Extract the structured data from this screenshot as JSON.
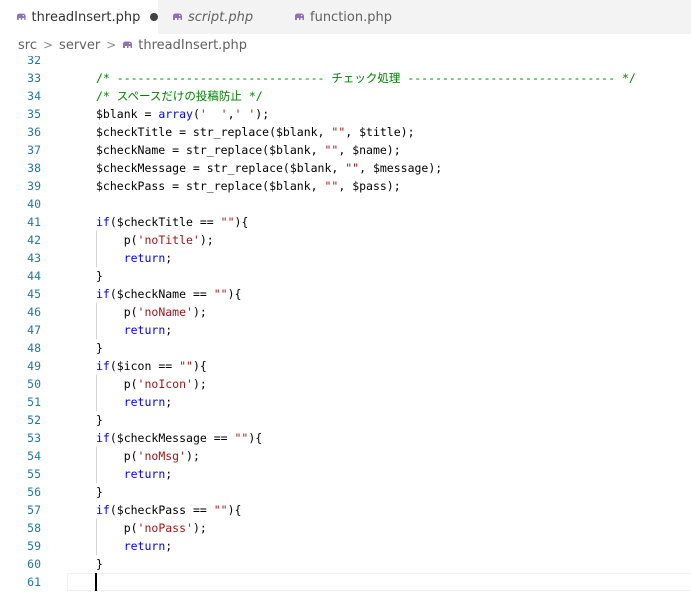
{
  "tabs": [
    {
      "label": "threadInsert.php",
      "icon": "php-elephant-icon",
      "active": true,
      "unsaved": true,
      "italic": false
    },
    {
      "label": "script.php",
      "icon": "php-elephant-icon",
      "active": false,
      "unsaved": false,
      "italic": true
    },
    {
      "label": "function.php",
      "icon": "php-elephant-icon",
      "active": false,
      "unsaved": false,
      "italic": false
    }
  ],
  "breadcrumb": {
    "items": [
      "src",
      "server",
      "threadInsert.php"
    ],
    "separator": ">"
  },
  "colors": {
    "line_number": "#237893",
    "comment": "#008000",
    "keyword": "#0000ff",
    "string": "#a31515",
    "php_icon": "#8f6fb8"
  },
  "editor": {
    "cursor_line": 61,
    "lines": [
      {
        "n": "32",
        "code": ""
      },
      {
        "n": "33",
        "code": "/* ------------------------------ チェック処理 ------------------------------ */"
      },
      {
        "n": "34",
        "code": "/* スペースだけの投稿防止 */"
      },
      {
        "n": "35",
        "code": "$blank = array('  ',' ');"
      },
      {
        "n": "36",
        "code": "$checkTitle = str_replace($blank, \"\", $title);"
      },
      {
        "n": "37",
        "code": "$checkName = str_replace($blank, \"\", $name);"
      },
      {
        "n": "38",
        "code": "$checkMessage = str_replace($blank, \"\", $message);"
      },
      {
        "n": "39",
        "code": "$checkPass = str_replace($blank, \"\", $pass);"
      },
      {
        "n": "40",
        "code": ""
      },
      {
        "n": "41",
        "code": "if($checkTitle == \"\"){"
      },
      {
        "n": "42",
        "code": "    p('noTitle');"
      },
      {
        "n": "43",
        "code": "    return;"
      },
      {
        "n": "44",
        "code": "}"
      },
      {
        "n": "45",
        "code": "if($checkName == \"\"){"
      },
      {
        "n": "46",
        "code": "    p('noName');"
      },
      {
        "n": "47",
        "code": "    return;"
      },
      {
        "n": "48",
        "code": "}"
      },
      {
        "n": "49",
        "code": "if($icon == \"\"){"
      },
      {
        "n": "50",
        "code": "    p('noIcon');"
      },
      {
        "n": "51",
        "code": "    return;"
      },
      {
        "n": "52",
        "code": "}"
      },
      {
        "n": "53",
        "code": "if($checkMessage == \"\"){"
      },
      {
        "n": "54",
        "code": "    p('noMsg');"
      },
      {
        "n": "55",
        "code": "    return;"
      },
      {
        "n": "56",
        "code": "}"
      },
      {
        "n": "57",
        "code": "if($checkPass == \"\"){"
      },
      {
        "n": "58",
        "code": "    p('noPass');"
      },
      {
        "n": "59",
        "code": "    return;"
      },
      {
        "n": "60",
        "code": "}"
      },
      {
        "n": "61",
        "code": ""
      }
    ]
  }
}
